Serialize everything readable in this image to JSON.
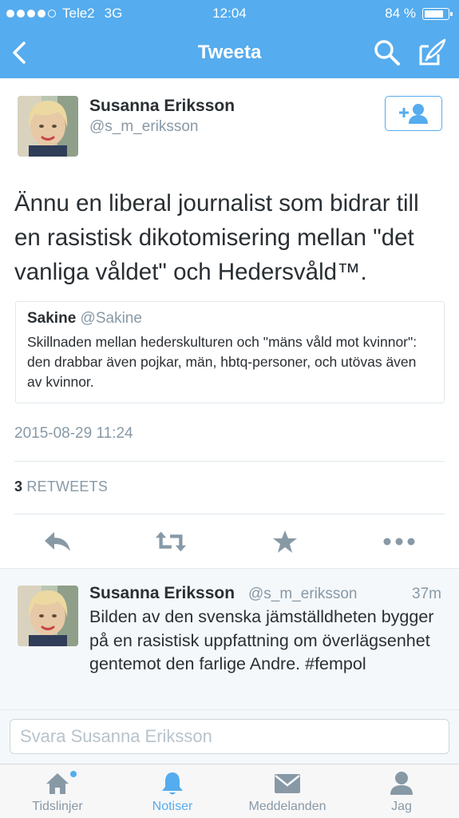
{
  "status_bar": {
    "carrier": "Tele2",
    "network": "3G",
    "time": "12:04",
    "battery": "84 %",
    "battery_level": 0.84
  },
  "nav": {
    "title": "Tweeta",
    "back_icon": "chevron-left-icon",
    "search_icon": "search-icon",
    "compose_icon": "compose-icon"
  },
  "tweet": {
    "author_name": "Susanna Eriksson",
    "author_handle": "@s_m_eriksson",
    "text": "Ännu en liberal journalist som bidrar till en rasistisk dikotomisering mellan \"det vanliga våldet\" och Hedersvåld™.",
    "quoted": {
      "name": "Sakine",
      "handle": "@Sakine",
      "text": "Skillnaden mellan hederskulturen och \"mäns våld mot kvinnor\": den drabbar även pojkar, män, hbtq-personer, och utövas även av kvinnor."
    },
    "timestamp": "2015-08-29 11:24",
    "retweet_count": "3",
    "retweets_label": "RETWEETS"
  },
  "actions": {
    "reply_icon": "reply-icon",
    "retweet_icon": "retweet-icon",
    "favorite_icon": "star-icon",
    "more_icon": "more-icon"
  },
  "reply": {
    "author_name": "Susanna Eriksson",
    "author_handle": "@s_m_eriksson",
    "time": "37m",
    "text": "Bilden av den svenska jämställdheten bygger på en rasistisk uppfattning om överlägsenhet gentemot den farlige Andre. #fempol"
  },
  "compose": {
    "placeholder": "Svara Susanna Eriksson"
  },
  "tabs": [
    {
      "label": "Tidslinjer",
      "icon": "home-icon",
      "active": false
    },
    {
      "label": "Notiser",
      "icon": "bell-icon",
      "active": true
    },
    {
      "label": "Meddelanden",
      "icon": "envelope-icon",
      "active": false
    },
    {
      "label": "Jag",
      "icon": "person-icon",
      "active": false
    }
  ],
  "colors": {
    "brand": "#55acee",
    "text": "#292f33",
    "muted": "#8899a6"
  }
}
